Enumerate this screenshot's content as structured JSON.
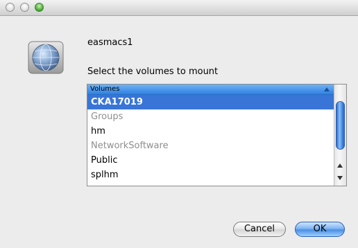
{
  "dialog": {
    "server_name": "easmacs1",
    "prompt": "Select the volumes to mount"
  },
  "volumes": {
    "header": "Volumes",
    "items": [
      {
        "label": "CKA17019",
        "selected": true,
        "enabled": true
      },
      {
        "label": "Groups",
        "selected": false,
        "enabled": false
      },
      {
        "label": "hm",
        "selected": false,
        "enabled": true
      },
      {
        "label": "NetworkSoftware",
        "selected": false,
        "enabled": false
      },
      {
        "label": "Public",
        "selected": false,
        "enabled": true
      },
      {
        "label": "splhm",
        "selected": false,
        "enabled": true
      }
    ]
  },
  "buttons": {
    "cancel": "Cancel",
    "ok": "OK"
  },
  "colors": {
    "selection": "#3875d7",
    "disabled_text": "#8e8e8e",
    "accent": "#4a8fe4"
  },
  "icons": {
    "server": "network-server-globe-icon"
  }
}
